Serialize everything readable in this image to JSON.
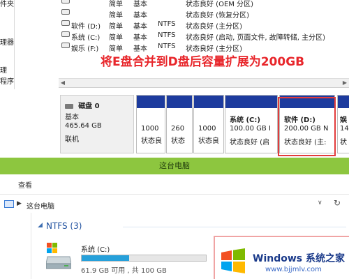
{
  "left_nav": [
    "件夹",
    "",
    "理器",
    "",
    "",
    "理",
    "程序"
  ],
  "volumes": [
    {
      "name": "",
      "layout": "简单",
      "type": "基本",
      "fs": "",
      "status": "状态良好 (OEM 分区)"
    },
    {
      "name": "",
      "layout": "简单",
      "type": "基本",
      "fs": "",
      "status": "状态良好 (恢复分区)"
    },
    {
      "name": "软件 (D:)",
      "layout": "简单",
      "type": "基本",
      "fs": "NTFS",
      "status": "状态良好 (主分区)"
    },
    {
      "name": "系统 (C:)",
      "layout": "简单",
      "type": "基本",
      "fs": "NTFS",
      "status": "状态良好 (启动, 页面文件, 故障转储, 主分区)"
    },
    {
      "name": "娱乐 (F:)",
      "layout": "简单",
      "type": "基本",
      "fs": "NTFS",
      "status": "状态良好 (主分区)"
    }
  ],
  "annotation": "将E盘合并到D盘后容量扩展为200GB",
  "disk": {
    "label": "磁盘 0",
    "type": "基本",
    "size": "465.64 GB",
    "state": "联机"
  },
  "partitions": [
    {
      "title": "",
      "size": "1000",
      "status": "状态良"
    },
    {
      "title": "",
      "size": "260",
      "status": "状态"
    },
    {
      "title": "",
      "size": "1000",
      "status": "状态良"
    },
    {
      "title": "系统  (C:)",
      "size": "100.00 GB I",
      "status": "状态良好 (启"
    },
    {
      "title": "软件  (D:)",
      "size": "200.00 GB N",
      "status": "状态良好 (主:"
    },
    {
      "title": "娱",
      "size": "14",
      "status": "状"
    }
  ],
  "explorer": {
    "title": "这台电脑",
    "ribbon_tab": "查看",
    "breadcrumb": "这台电脑",
    "group_label": "NTFS (3)",
    "drive": {
      "name": "系统 (C:)",
      "free_text": "61.9 GB 可用 , 共 100 GB",
      "used_fraction": 0.38
    }
  },
  "watermark": {
    "title": "Windows 系统之家",
    "url": "www.bjjmlv.com"
  }
}
